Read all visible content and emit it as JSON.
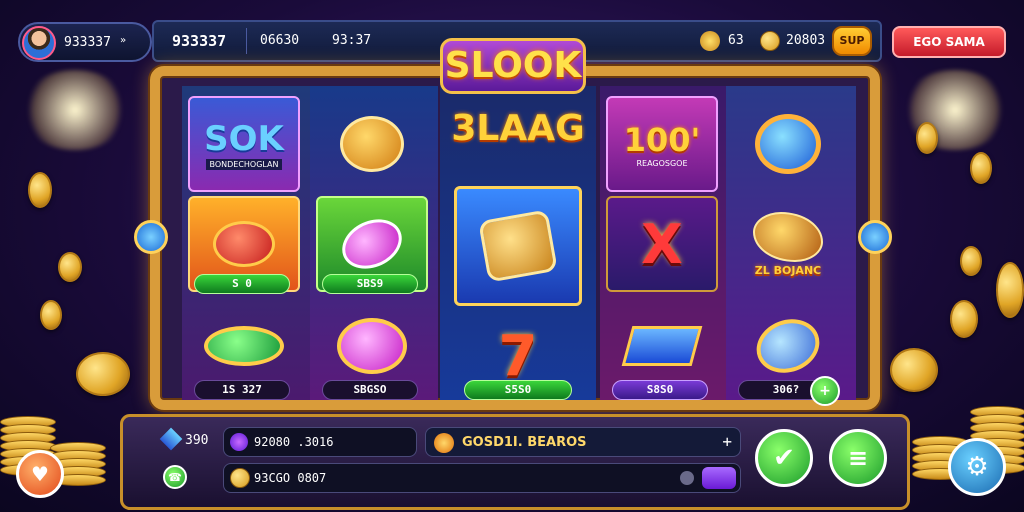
{
  "header": {
    "player_id": "933337",
    "player_suffix": "»",
    "balance": "933337",
    "stat_a": "06630",
    "stat_b": "93:37",
    "gems": "63",
    "coins": "20803",
    "small_button": "SUP",
    "promo_button": "EGO SAMA"
  },
  "logo": "SLOOK",
  "reels": {
    "r1": {
      "top_title": "SOK",
      "top_caption": "BONDECHOGLAN",
      "mid_value": "S 0",
      "bot_value": "1S 327"
    },
    "r2": {
      "mid_value": "SBS9",
      "bot_value": "SBGSO"
    },
    "r3": {
      "headline": "3LAAG",
      "bot_value": "S5S0"
    },
    "r4": {
      "top_title": "100'",
      "top_caption": "REAGOSGOE",
      "mid_title": "X",
      "bot_value": "S8S0"
    },
    "r5": {
      "mid_caption": "ZL BOJANC",
      "bot_value": "306?"
    }
  },
  "bottom": {
    "gems_value": "390",
    "field_a": "92080 .3016",
    "banner": "GOSD1I. BEAROS",
    "field_b": "93CGO 0807"
  },
  "icons": {
    "settings": "gear-icon",
    "home": "heart-shield-icon",
    "spin": "check-leaf-icon",
    "menu": "menu-icon",
    "plus": "plus-icon",
    "phone": "phone-icon"
  },
  "colors": {
    "frame_gold": "#d99c3a",
    "accent_green": "#1a9a2a",
    "accent_red": "#c41a2a"
  }
}
